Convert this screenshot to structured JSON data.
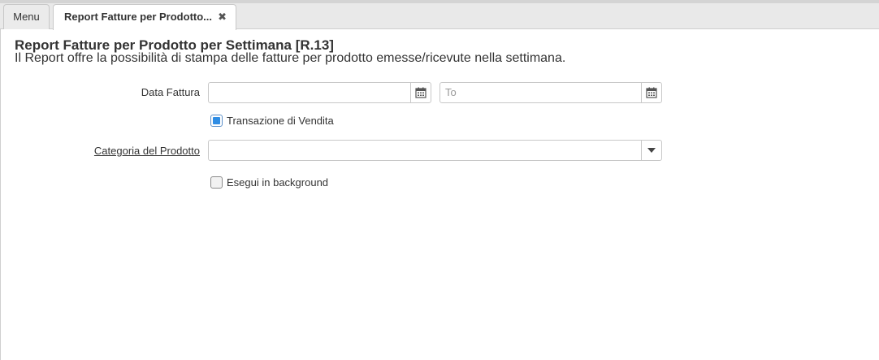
{
  "tabs": {
    "menu_label": "Menu",
    "active_label": "Report Fatture per Prodotto...",
    "close_glyph": "✖"
  },
  "header": {
    "title": "Report Fatture per Prodotto per Settimana [R.13]",
    "description": "Il Report offre la possibilità di stampa delle fatture per prodotto emesse/ricevute nella settimana."
  },
  "form": {
    "data_fattura": {
      "label": "Data Fattura",
      "from_value": "",
      "to_placeholder": "To",
      "calendar_icon": "calendar-icon"
    },
    "transazione_vendita": {
      "label": "Transazione di Vendita",
      "checked": true
    },
    "categoria_prodotto": {
      "label": "Categoria del Prodotto",
      "value": "",
      "dropdown_icon": "chevron-down-icon"
    },
    "esegui_background": {
      "label": "Esegui in background",
      "checked": false
    }
  },
  "colors": {
    "accent": "#2f8de4",
    "border": "#c8c8c8",
    "tabbar": "#e9e9e9"
  }
}
